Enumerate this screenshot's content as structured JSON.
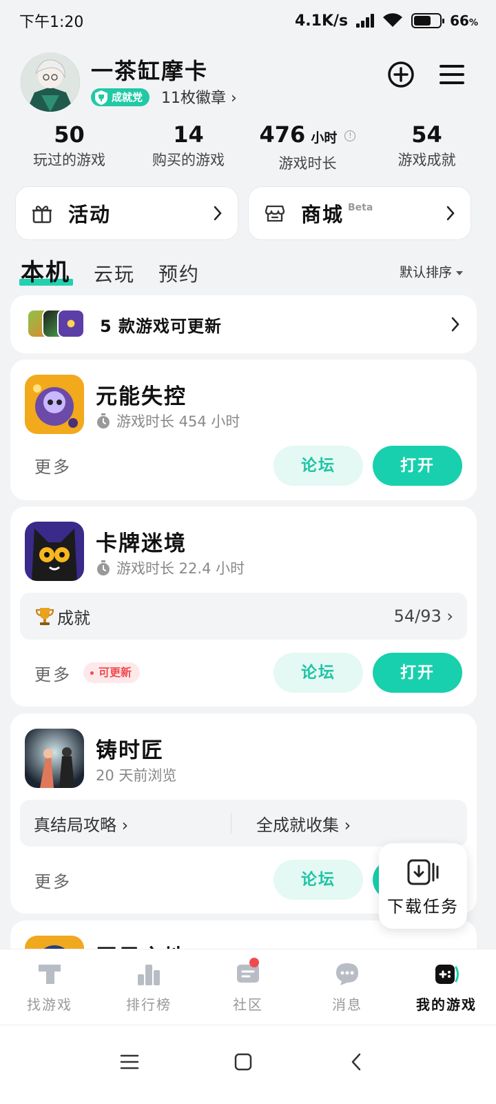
{
  "status_bar": {
    "time": "下午1:20",
    "net_speed": "4.1K/s",
    "battery": "66",
    "battery_suffix": "%",
    "battery_level": 0.66
  },
  "profile": {
    "username": "一茶缸摩卡",
    "title_badge": "成就党",
    "badges_link": "11枚徽章 ›"
  },
  "stats": [
    {
      "value": "50",
      "unit": "",
      "label": "玩过的游戏"
    },
    {
      "value": "14",
      "unit": "",
      "label": "购买的游戏"
    },
    {
      "value": "476",
      "unit": "小时",
      "label": "游戏时长"
    },
    {
      "value": "54",
      "unit": "",
      "label": "游戏成就"
    }
  ],
  "entries": {
    "activity": "活动",
    "mall": "商城",
    "mall_beta": "Beta"
  },
  "tabs": [
    "本机",
    "云玩",
    "预约"
  ],
  "sort_label": "默认排序",
  "update_bar": {
    "text": "5 款游戏可更新"
  },
  "games": [
    {
      "name": "元能失控",
      "meta": "游戏时长 454 小时",
      "more": "更多",
      "forum": "论坛",
      "open": "打开"
    },
    {
      "name": "卡牌迷境",
      "meta": "游戏时长 22.4 小时",
      "achievement_label": "成就",
      "achievement_value": "54/93 ›",
      "more": "更多",
      "updatable": "可更新",
      "forum": "论坛",
      "open": "打开"
    },
    {
      "name": "铸时匠",
      "meta": "20 天前浏览",
      "guide_1": "真结局攻略 ›",
      "guide_2": "全成就收集 ›",
      "more": "更多",
      "forum": "论坛"
    },
    {
      "name": "恶果之地"
    }
  ],
  "download_task": "下载任务",
  "bottom_nav": [
    "找游戏",
    "排行榜",
    "社区",
    "消息",
    "我的游戏"
  ],
  "colors": {
    "accent": "#18d0ad",
    "accent_soft": "#e4f8f4",
    "alert": "#f04a4f",
    "background": "#f2f3f5"
  }
}
